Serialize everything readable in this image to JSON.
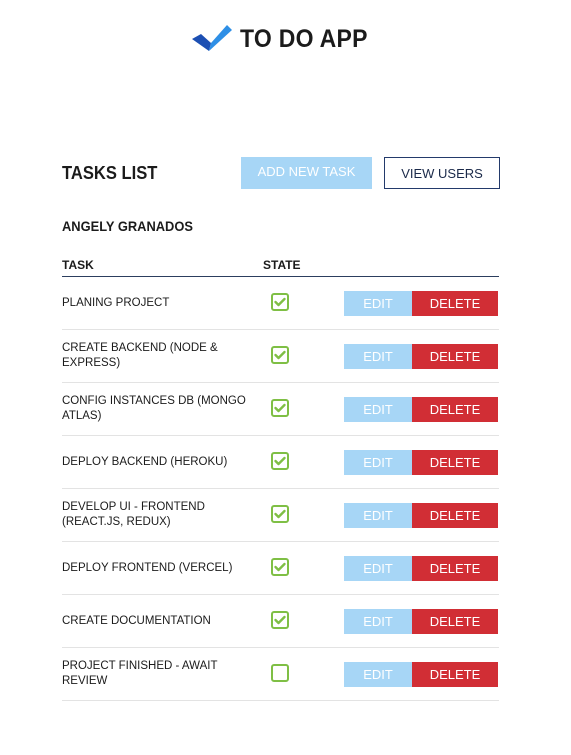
{
  "app": {
    "title": "TO DO APP",
    "logo_icon": "check-logo-icon",
    "logo_colors": {
      "light": "#2e8fe6",
      "dark": "#1c4fb3"
    }
  },
  "toolbar": {
    "title": "TASKS LIST",
    "add_label": "ADD NEW TASK",
    "view_users_label": "VIEW USERS"
  },
  "user": {
    "name": "ANGELY GRANADOS"
  },
  "table": {
    "headers": {
      "task": "TASK",
      "state": "STATE"
    },
    "edit_label": "EDIT",
    "delete_label": "DELETE",
    "rows": [
      {
        "task": "PLANING PROJECT",
        "done": true
      },
      {
        "task": "CREATE BACKEND (NODE & EXPRESS)",
        "done": true
      },
      {
        "task": "CONFIG INSTANCES DB (MONGO ATLAS)",
        "done": true
      },
      {
        "task": "DEPLOY BACKEND (HEROKU)",
        "done": true
      },
      {
        "task": "DEVELOP UI - FRONTEND (REACT.JS, REDUX)",
        "done": true
      },
      {
        "task": "DEPLOY FRONTEND (VERCEL)",
        "done": true
      },
      {
        "task": "CREATE DOCUMENTATION",
        "done": true
      },
      {
        "task": "PROJECT FINISHED - AWAIT REVIEW",
        "done": false
      }
    ]
  },
  "colors": {
    "accent_light": "#a7d6f6",
    "delete": "#d12e35",
    "check": "#7fbf45",
    "navy": "#233a6b"
  }
}
